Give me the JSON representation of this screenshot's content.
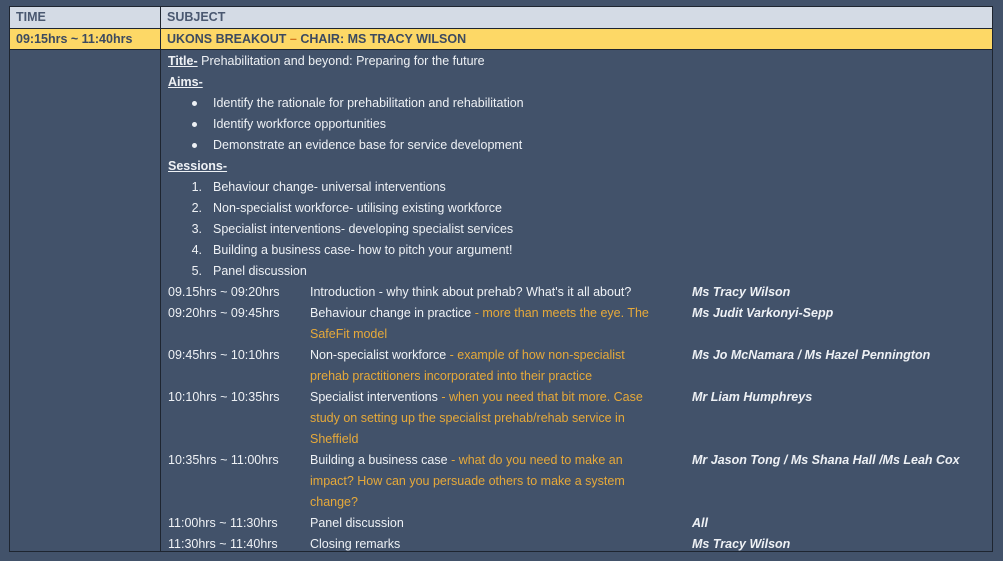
{
  "header": {
    "time_label": "TIME",
    "subject_label": "SUBJECT"
  },
  "highlight": {
    "time": "09:15hrs ~ 11:40hrs",
    "title_main": "UKONS BREAKOUT",
    "title_sep": " – ",
    "title_chair": "CHAIR: MS TRACY WILSON"
  },
  "details": {
    "title_label": "Title-",
    "title_text": " Prehabilitation and beyond: Preparing for the future",
    "aims_label": "Aims-",
    "aims": [
      "Identify the rationale for prehabilitation and rehabilitation",
      "Identify workforce opportunities",
      "Demonstrate an evidence base for service development"
    ],
    "sessions_label": "Sessions-",
    "sessions": [
      {
        "num": "1.",
        "text": "Behaviour change- universal interventions"
      },
      {
        "num": "2.",
        "text": "Non-specialist workforce- utilising existing workforce"
      },
      {
        "num": "3.",
        "text": "Specialist interventions- developing specialist services"
      },
      {
        "num": "4.",
        "text": "Building a business case- how to pitch your argument!"
      },
      {
        "num": "5.",
        "text": "Panel discussion"
      }
    ]
  },
  "schedule": [
    {
      "time": "09.15hrs ~ 09:20hrs",
      "topic": "Introduction - why think about prehab? What's it all about?",
      "sub": "",
      "speaker": "Ms Tracy Wilson"
    },
    {
      "time": "09:20hrs ~ 09:45hrs",
      "topic": "Behaviour change in practice",
      "sub": " - more than meets the eye. The SafeFit model",
      "speaker": "Ms Judit Varkonyi-Sepp"
    },
    {
      "time": "09:45hrs ~ 10:10hrs",
      "topic": "Non-specialist workforce",
      "sub": " - example of how non-specialist prehab practitioners incorporated into their practice",
      "speaker": "Ms Jo McNamara / Ms Hazel Pennington"
    },
    {
      "time": "10:10hrs ~ 10:35hrs",
      "topic": "Specialist interventions",
      "sub": " - when you need that bit more. Case study on setting up the specialist prehab/rehab service in Sheffield",
      "speaker": "Mr Liam Humphreys"
    },
    {
      "time": "10:35hrs ~ 11:00hrs",
      "topic": "Building a business case",
      "sub": " - what do you need to make an impact? How can you persuade others to make a system change?",
      "speaker": "Mr Jason Tong / Ms Shana Hall /Ms Leah Cox"
    },
    {
      "time": "11:00hrs ~ 11:30hrs",
      "topic": "Panel discussion",
      "sub": "",
      "speaker": "All"
    },
    {
      "time": "11:30hrs ~ 11:40hrs",
      "topic": "Closing remarks",
      "sub": "",
      "speaker": "Ms Tracy Wilson"
    }
  ]
}
